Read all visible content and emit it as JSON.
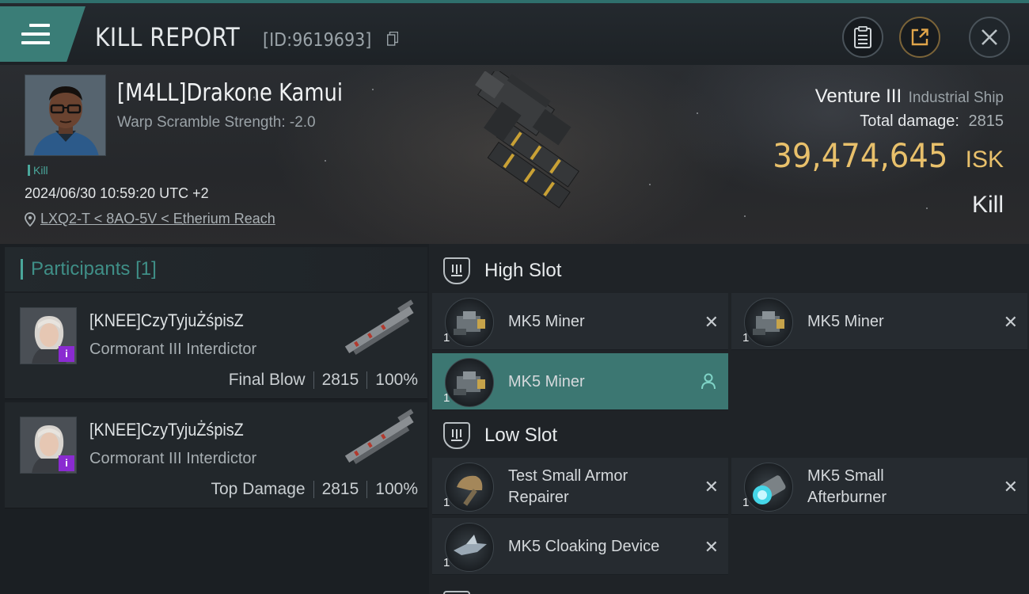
{
  "header": {
    "title": "KILL REPORT",
    "report_id": "[ID:9619693]",
    "icons": [
      "menu-icon",
      "copy-icon",
      "clipboard-icon",
      "share-icon",
      "close-icon"
    ]
  },
  "victim": {
    "pilot": "[M4LL]Drakone Kamui",
    "scramble": "Warp Scramble Strength: -2.0",
    "tag": "Kill",
    "datetime": "2024/06/30 10:59:20 UTC +2",
    "location": "LXQ2-T < 8AO-5V < Etherium Reach",
    "ship_name": "Venture III",
    "ship_class": "Industrial Ship",
    "total_damage_label": "Total damage:",
    "total_damage": "2815",
    "isk_value": "39,474,645",
    "isk_unit": "ISK",
    "result": "Kill"
  },
  "participants": {
    "title": "Participants",
    "count": "[1]",
    "rows": [
      {
        "name": "[KNEE]CzyTyjuŻśpisZ",
        "ship": "Cormorant III Interdictor",
        "role": "Final Blow",
        "damage": "2815",
        "percent": "100%",
        "badge": "i"
      },
      {
        "name": "[KNEE]CzyTyjuŻśpisZ",
        "ship": "Cormorant III Interdictor",
        "role": "Top Damage",
        "damage": "2815",
        "percent": "100%",
        "badge": "i"
      }
    ]
  },
  "fitting": {
    "high_slot": {
      "title": "High Slot",
      "modules": [
        {
          "name": "MK5 Miner",
          "qty": "1",
          "status": "destroyed"
        },
        {
          "name": "MK5 Miner",
          "qty": "1",
          "status": "destroyed"
        },
        {
          "name": "MK5 Miner",
          "qty": "1",
          "status": "dropped"
        }
      ]
    },
    "low_slot": {
      "title": "Low Slot",
      "modules": [
        {
          "name_line1": "Test Small Armor",
          "name_line2": "Repairer",
          "qty": "1",
          "status": "destroyed"
        },
        {
          "name_line1": "MK5 Small",
          "name_line2": "Afterburner",
          "qty": "1",
          "status": "destroyed"
        },
        {
          "name": "MK5 Cloaking Device",
          "qty": "1",
          "status": "destroyed"
        }
      ]
    },
    "status_glyphs": {
      "destroyed": "✕"
    },
    "colors": {
      "accent": "#3c7772",
      "isk": "#e8c06b",
      "teal_text": "#3f8f87"
    }
  }
}
